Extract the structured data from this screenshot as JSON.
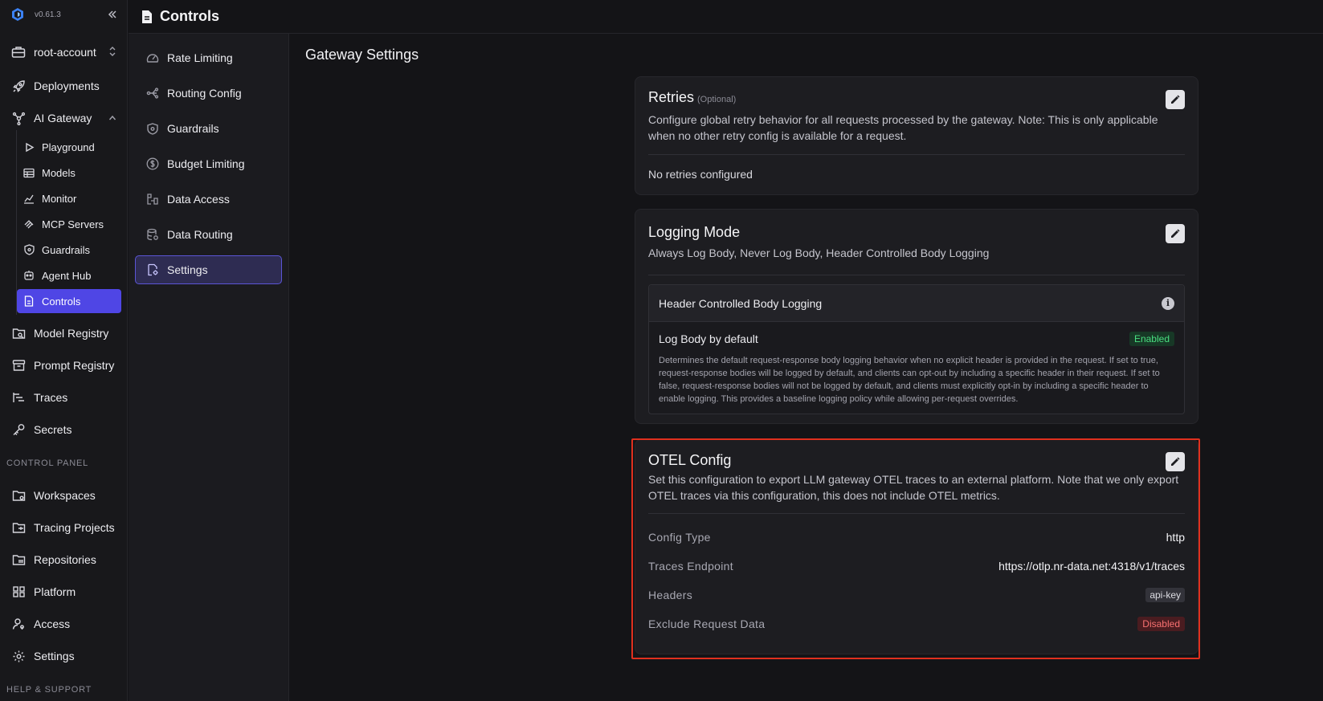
{
  "app": {
    "version": "v0.61.3",
    "account": "root-account"
  },
  "header": {
    "title": "Controls"
  },
  "sidebar": {
    "items": [
      {
        "label": "Deployments",
        "icon": "rocket-icon"
      },
      {
        "label": "AI Gateway",
        "icon": "gateway-icon"
      },
      {
        "label": "Model Registry",
        "icon": "model-registry-icon"
      },
      {
        "label": "Prompt Registry",
        "icon": "prompt-registry-icon"
      },
      {
        "label": "Traces",
        "icon": "traces-icon"
      },
      {
        "label": "Secrets",
        "icon": "key-icon"
      }
    ],
    "ai_gateway_children": [
      {
        "label": "Playground",
        "icon": "play-icon"
      },
      {
        "label": "Models",
        "icon": "table-icon"
      },
      {
        "label": "Monitor",
        "icon": "chart-icon"
      },
      {
        "label": "MCP Servers",
        "icon": "mcp-icon"
      },
      {
        "label": "Guardrails",
        "icon": "shield-icon"
      },
      {
        "label": "Agent Hub",
        "icon": "bot-icon"
      },
      {
        "label": "Controls",
        "icon": "document-icon",
        "active": true
      }
    ],
    "control_panel_heading": "CONTROL PANEL",
    "control_panel_items": [
      {
        "label": "Workspaces",
        "icon": "workspaces-icon"
      },
      {
        "label": "Tracing Projects",
        "icon": "tracing-projects-icon"
      },
      {
        "label": "Repositories",
        "icon": "repositories-icon"
      },
      {
        "label": "Platform",
        "icon": "platform-icon"
      },
      {
        "label": "Access",
        "icon": "user-key-icon"
      },
      {
        "label": "Settings",
        "icon": "gear-icon"
      }
    ],
    "help_heading": "HELP & SUPPORT"
  },
  "subnav": {
    "items": [
      {
        "label": "Rate Limiting",
        "icon": "gauge-icon"
      },
      {
        "label": "Routing Config",
        "icon": "routing-icon"
      },
      {
        "label": "Guardrails",
        "icon": "shield-icon"
      },
      {
        "label": "Budget Limiting",
        "icon": "dollar-icon"
      },
      {
        "label": "Data Access",
        "icon": "data-access-icon"
      },
      {
        "label": "Data Routing",
        "icon": "database-icon"
      },
      {
        "label": "Settings",
        "icon": "settings-doc-icon",
        "active": true
      }
    ]
  },
  "main": {
    "title": "Gateway Settings",
    "retries": {
      "title": "Retries",
      "optional": "(Optional)",
      "description": "Configure global retry behavior for all requests processed by the gateway. Note: This is only applicable when no other retry config is available for a request.",
      "empty": "No retries configured"
    },
    "logging": {
      "title": "Logging Mode",
      "description": "Always Log Body, Never Log Body, Header Controlled Body Logging",
      "mode": "Header Controlled Body Logging",
      "setting_label": "Log Body by default",
      "setting_status": "Enabled",
      "setting_description": "Determines the default request-response body logging behavior when no explicit header is provided in the request. If set to true, request-response bodies will be logged by default, and clients can opt-out by including a specific header in their request. If set to false, request-response bodies will not be logged by default, and clients must explicitly opt-in by including a specific header to enable logging. This provides a baseline logging policy while allowing per-request overrides."
    },
    "otel": {
      "title": "OTEL Config",
      "description": "Set this configuration to export LLM gateway OTEL traces to an external platform. Note that we only export OTEL traces via this configuration, this does not include OTEL metrics.",
      "rows": [
        {
          "key": "Config Type",
          "value": "http"
        },
        {
          "key": "Traces Endpoint",
          "value": "https://otlp.nr-data.net:4318/v1/traces"
        },
        {
          "key": "Headers",
          "value": "api-key"
        },
        {
          "key": "Exclude Request Data",
          "value": "Disabled"
        }
      ]
    }
  },
  "colors": {
    "accent": "#4f46e5",
    "enabled": "#4ade80",
    "disabled": "#f87171",
    "highlight_border": "#e0301e"
  }
}
